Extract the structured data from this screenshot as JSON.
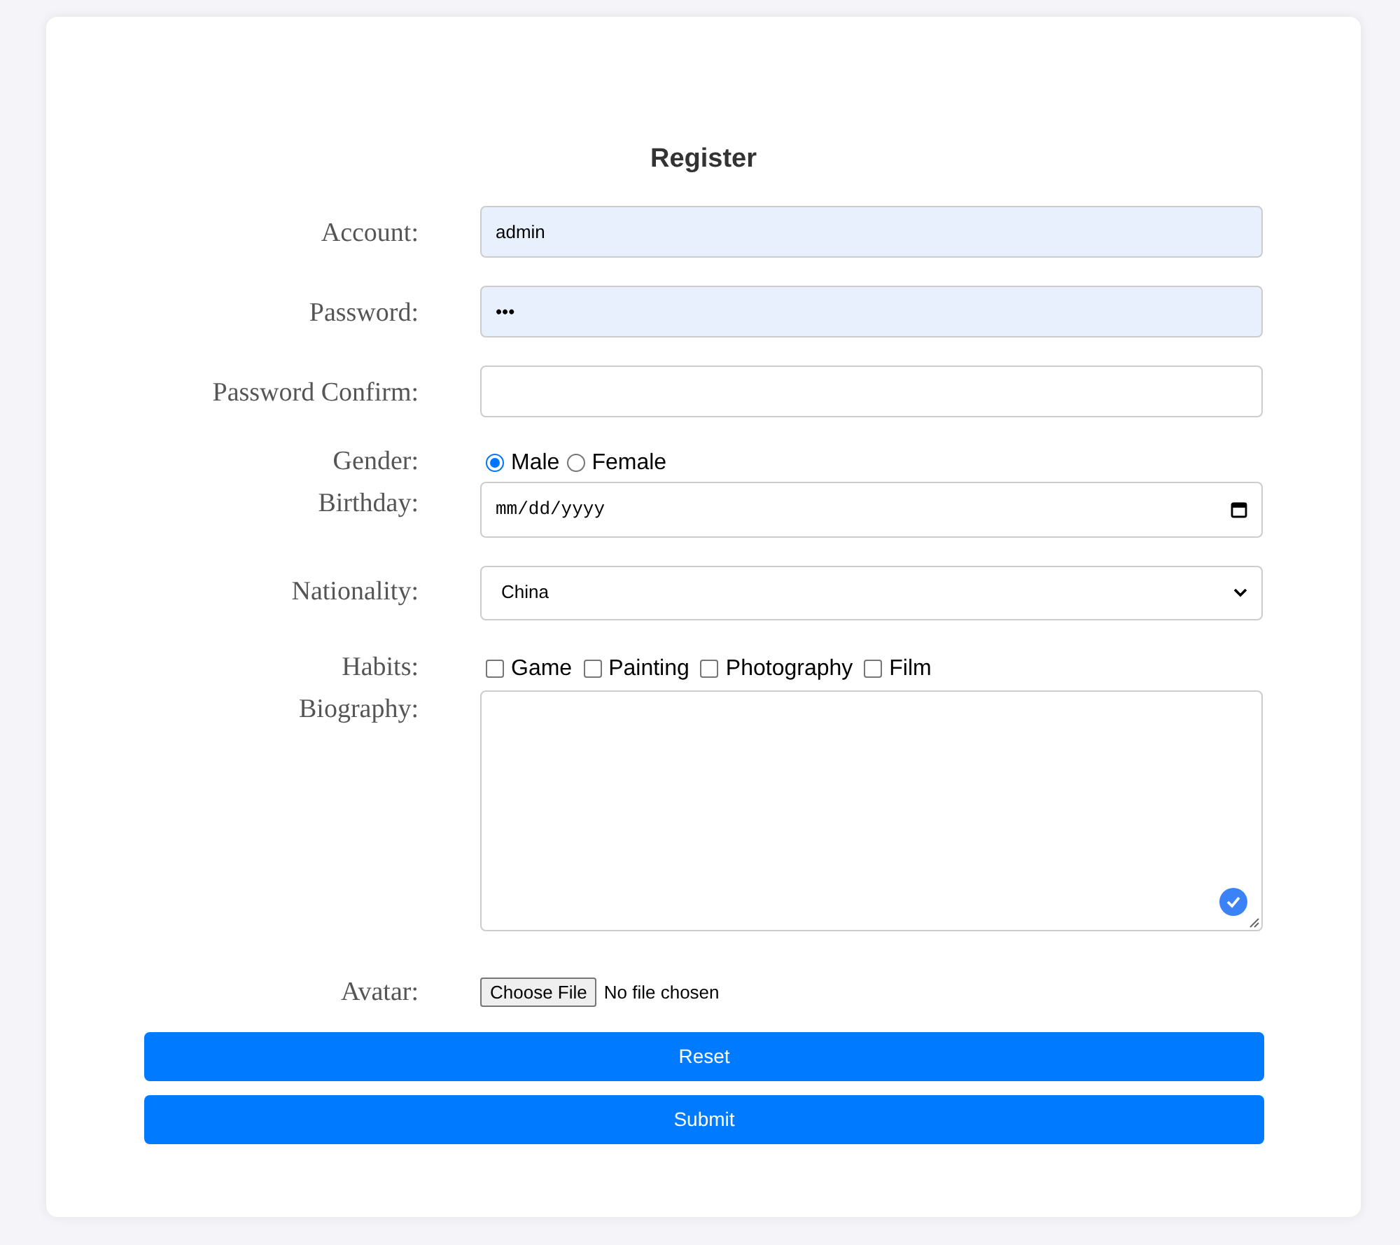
{
  "form": {
    "title": "Register",
    "fields": [
      {
        "kind": "text",
        "label": "Account:",
        "value": "admin",
        "autofilled": true
      },
      {
        "kind": "text",
        "label": "Password:",
        "value": "•••",
        "autofilled": true
      },
      {
        "kind": "text",
        "label": "Password Confirm:",
        "autofilled": false
      },
      {
        "kind": "radio",
        "label": "Gender:",
        "options": [
          {
            "label": "Male",
            "selected": true
          },
          {
            "label": "Female",
            "selected": false
          }
        ]
      },
      {
        "kind": "date",
        "label": "Birthday:",
        "placeholder": "mm/dd/yyyy"
      },
      {
        "kind": "select",
        "label": "Nationality:",
        "value": "China"
      },
      {
        "kind": "checkbox",
        "label": "Habits:",
        "options": [
          {
            "label": "Game",
            "checked": false
          },
          {
            "label": "Painting",
            "checked": false
          },
          {
            "label": "Photography",
            "checked": false
          },
          {
            "label": "Film",
            "checked": false
          }
        ]
      },
      {
        "kind": "textarea",
        "label": "Biography:"
      },
      {
        "kind": "file",
        "label": "Avatar:",
        "button": "Choose File",
        "status": "No file chosen"
      }
    ],
    "buttons": [
      "Reset",
      "Submit"
    ]
  }
}
